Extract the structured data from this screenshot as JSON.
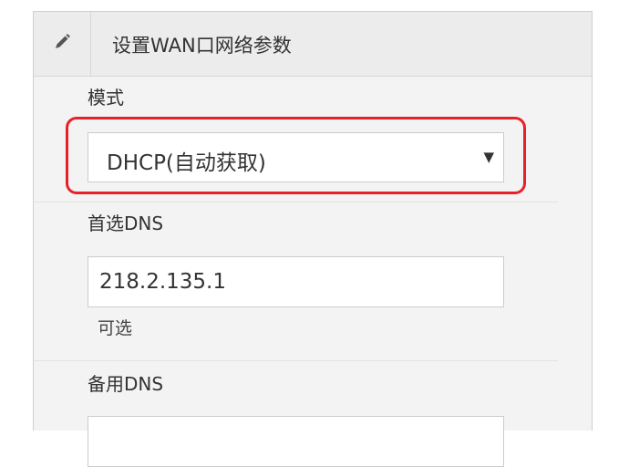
{
  "header": {
    "icon": "pencil-icon",
    "title": "设置WAN口网络参数"
  },
  "mode": {
    "label": "模式",
    "selected": "DHCP(自动获取)",
    "arrow": "▼"
  },
  "primary_dns": {
    "label": "首选DNS",
    "value": "218.2.135.1",
    "hint": "可选"
  },
  "secondary_dns": {
    "label": "备用DNS",
    "value": ""
  },
  "colors": {
    "highlight": "#e8202a",
    "panel_bg": "#f3f3f3"
  }
}
